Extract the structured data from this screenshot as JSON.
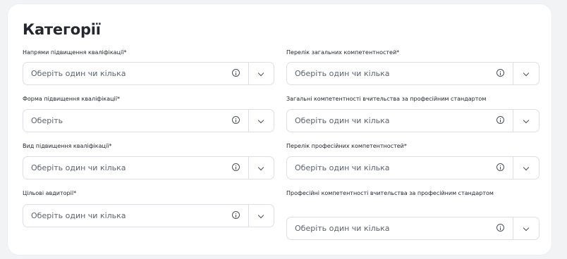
{
  "section": {
    "title": "Категорії"
  },
  "left_fields": [
    {
      "label": "Напрями підвищення кваліфікації*",
      "placeholder": "Оберіть один чи кілька"
    },
    {
      "label": "Форма підвищення кваліфікації*",
      "placeholder": "Оберіть"
    },
    {
      "label": "Вид підвищення кваліфікації*",
      "placeholder": "Оберіть один чи кілька"
    },
    {
      "label": "Цільові авдиторії*",
      "placeholder": "Оберіть один чи кілька"
    }
  ],
  "right_fields": [
    {
      "label": "Перелік загальних компетентностей*",
      "placeholder": "Оберіть один чи кілька"
    },
    {
      "label": "Загальні компетентності вчительства за професійним стандартом",
      "placeholder": "Оберіть один чи кілька"
    },
    {
      "label": "Перелік професійних компетентностей*",
      "placeholder": "Оберіть один чи кілька"
    },
    {
      "label": "Професійні компетентності вчительства за професійним стандартом",
      "placeholder": "Оберіть один чи кілька"
    }
  ],
  "icons": {
    "info": "info-icon",
    "dropdown": "chevron-down-icon"
  }
}
